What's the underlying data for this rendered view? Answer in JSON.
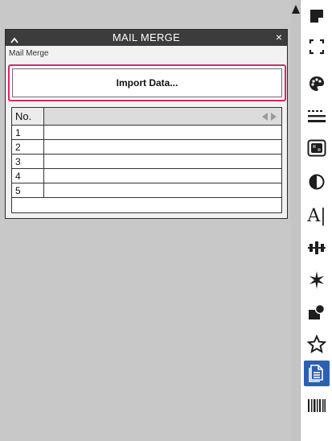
{
  "panel": {
    "title": "MAIL MERGE",
    "subtitle": "Mail Merge",
    "import_button": "Import Data...",
    "close_glyph": "×"
  },
  "table": {
    "header": "No.",
    "rows": [
      "1",
      "2",
      "3",
      "4",
      "5"
    ]
  },
  "toolbar": {
    "icons": [
      "page-corner-icon",
      "frame-corners-icon",
      "palette-icon",
      "lines-icon",
      "pattern-icon",
      "contrast-icon",
      "text-icon",
      "align-icon",
      "sparkle-icon",
      "shapes-icon",
      "star-icon",
      "mail-merge-icon",
      "barcode-icon"
    ],
    "active": "mail-merge-icon",
    "text_icon_label": "A|"
  },
  "colors": {
    "accent": "#d9266b",
    "active_tool": "#2d5fb0",
    "title_bar": "#3c3c3c"
  }
}
